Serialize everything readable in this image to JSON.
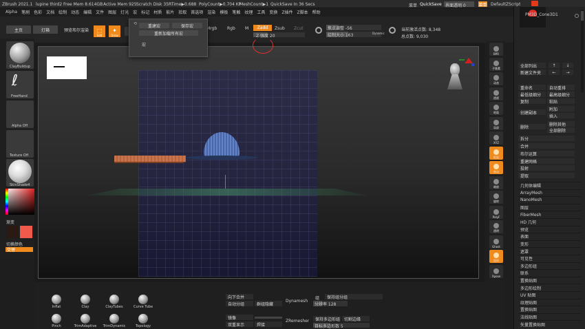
{
  "title_bar": {
    "app": "ZBrush 2021.1",
    "doc": "lupine third2",
    "free_mem": "Free Mem 8.614GB",
    "active_mem": "Active Mem 925",
    "scratch": "Scratch Disk 35",
    "rtime": "RTime▶0.688",
    "polycount": "PolyCount▶0.704 KP",
    "meshcount": "MeshCount▶1",
    "quicksave_in": "QuickSave In 36 Secs",
    "menu_label": "菜单",
    "quicksave": "QuickSave",
    "transparency_label": "界面透明 0",
    "menus_btn": "菜单",
    "script": "DefaultZScript"
  },
  "menu_bar": [
    "Alpha",
    "笔刷",
    "色彩",
    "文档",
    "绘制",
    "动态",
    "编辑",
    "文件",
    "图层",
    "灯光",
    "宏",
    "标记",
    "材质",
    "影片",
    "拾取",
    "首选项",
    "渲染",
    "模板",
    "笔触",
    "纹理",
    "工具",
    "变换",
    "Z插件",
    "Z脚本",
    "帮助"
  ],
  "top_shelf": {
    "home": "主页",
    "lightbox": "灯箱",
    "live_boolean": "预览布尔渲染",
    "edit": "Edit",
    "draw": "Draw",
    "mrgb": "Mrgb",
    "rgb": "Rgb",
    "m": "M",
    "zadd": "Zadd",
    "zsub": "Zsub",
    "zcut": "Zcut",
    "z_intensity": "Z 强度 20",
    "focal_shift": "焦点调整 -56",
    "draw_size": "绘制大小 163",
    "dynamic": "Dynamic",
    "active_points": "当前激活点数: 8,348",
    "total_points": "总点数: 9,030"
  },
  "popup_menu": {
    "items": [
      "重建宏",
      "保存宏",
      "重新加载所有宏",
      "宏"
    ]
  },
  "left_shelf": {
    "brush": "ClayBuildup",
    "stroke": "FreeHand",
    "alpha": "Alpha Off",
    "texture": "Texture Off",
    "material": "SkinShade4",
    "gradient": "渐变",
    "switch_color": "切换颜色",
    "alternate": "交替"
  },
  "right_shelf": [
    "BPR",
    "子像素",
    "动态",
    "透视",
    "地面",
    "局部",
    "XYZ",
    "框架",
    "移动",
    "缩放",
    "旋转",
    "PolyF",
    "透明",
    "Ghost",
    "固体",
    "Xpose"
  ],
  "subtool": {
    "name": "PM3D_Cone3D1",
    "list_all": "全部列出",
    "new_folder": "新建文件夹",
    "rename": "重命名",
    "auto_reorder": "自动重排",
    "lowest_res": "最低级细分",
    "highest_res": "最高级细分",
    "copy": "复制",
    "paste": "粘贴",
    "append": "附加",
    "duplicate": "创建副本",
    "insert": "插入",
    "delete": "删除",
    "del_other": "删除其他",
    "del_all": "全部删除",
    "split": "拆分",
    "merge": "合并",
    "boolean": "布尔运算",
    "remesh": "重建网格",
    "project": "投射",
    "extract": "提取"
  },
  "tool_palette": [
    "几何体编辑",
    "ArrayMesh",
    "NanoMesh",
    "图层",
    "FiberMesh",
    "HD 几何",
    "预览",
    "表面",
    "变形",
    "遮罩",
    "可见性",
    "多边形组",
    "联系",
    "置换贴图",
    "多边形绘制",
    "UV 贴图",
    "纹理贴图",
    "置换贴图",
    "法线贴图",
    "矢量置换贴图"
  ],
  "bottom_shelf": {
    "brushes": [
      "Inflat",
      "Clay",
      "ClayTubes",
      "Curve Tube",
      "Pinch",
      "TrimAdaptive",
      "TrimDynamic",
      "Topology"
    ],
    "divide": "向下合并",
    "auto_groups": "自动分组",
    "group_hidden": "群组隐藏",
    "mirror": "镜像",
    "double": "双重显示",
    "weld": "焊接",
    "dynamesh": "Dynamesh",
    "group_label": "组",
    "keep_groups": "保持组分组",
    "resolution": "分辨率 128",
    "zremesher": "ZRemesher",
    "keep_poly": "保持多边形组",
    "keep_edges": "切割边缘",
    "target_poly": "目标多边形数 5"
  },
  "colors": {
    "accent": "#f08a1c",
    "primary_color": "#2a1a14",
    "secondary_color": "#f05a4a"
  }
}
